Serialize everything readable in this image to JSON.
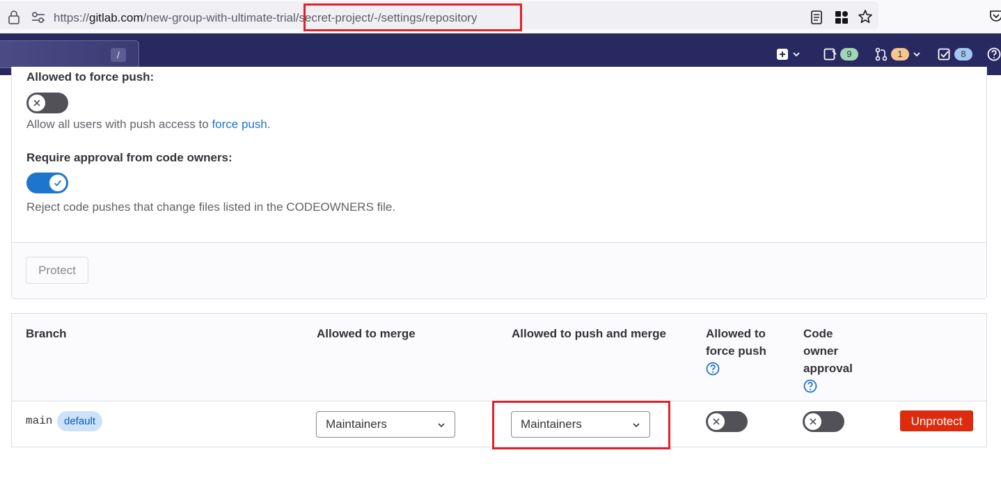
{
  "browser": {
    "url_prefix": "https://",
    "url_host": "gitlab.com",
    "url_path": "/new-group-with-ultimate-trial/secret-project/-/settings/repository"
  },
  "nav": {
    "search_shortcut": "/",
    "issues_count": "9",
    "merge_requests_count": "1",
    "todos_count": "8"
  },
  "form": {
    "force_push_label": "Allowed to force push:",
    "force_push_help_prefix": "Allow all users with push access to ",
    "force_push_help_link": "force push",
    "force_push_help_suffix": ".",
    "force_push_enabled": false,
    "code_owner_label": "Require approval from code owners:",
    "code_owner_help": "Reject code pushes that change files listed in the CODEOWNERS file.",
    "code_owner_enabled": true,
    "protect_button": "Protect"
  },
  "table": {
    "headers": {
      "branch": "Branch",
      "merge": "Allowed to merge",
      "push_merge": "Allowed to push and merge",
      "force_push_line1": "Allowed to",
      "force_push_line2": "force push",
      "code_owner_line1": "Code",
      "code_owner_line2": "owner",
      "code_owner_line3": "approval"
    },
    "rows": [
      {
        "branch": "main",
        "badge": "default",
        "allowed_to_merge": "Maintainers",
        "allowed_to_push_and_merge": "Maintainers",
        "force_push": false,
        "code_owner_approval": false,
        "action": "Unprotect"
      }
    ]
  },
  "colors": {
    "nav_bg": "#292961",
    "toggle_on": "#1f75cb",
    "toggle_off": "#535158",
    "danger": "#dd2b0e",
    "highlight": "#e0202a"
  }
}
